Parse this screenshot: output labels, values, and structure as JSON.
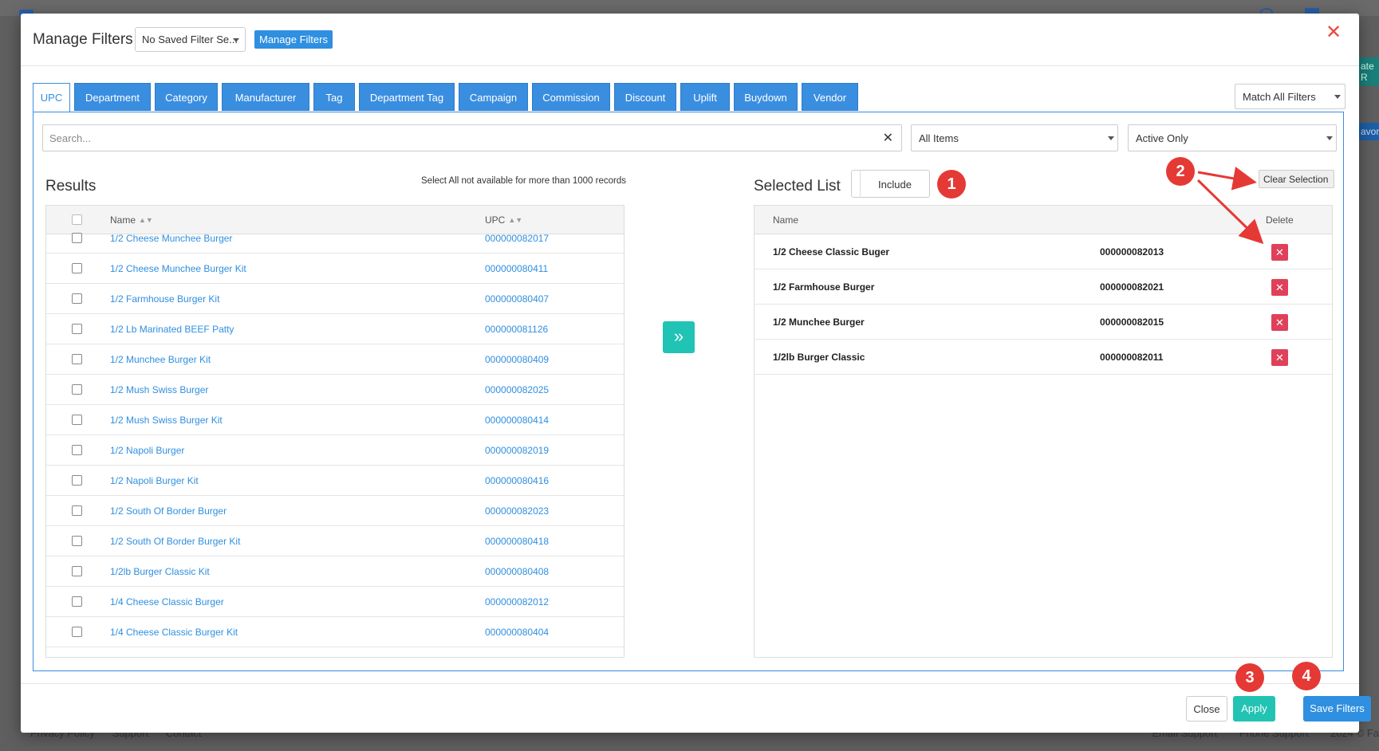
{
  "background": {
    "footer_links": [
      "Privacy Policy",
      "Support",
      "Contact"
    ],
    "footer_right": [
      "Email Support",
      "Phone Support",
      "2024 © Fa"
    ],
    "right_btn1": "ate R",
    "right_btn2": "avor"
  },
  "modal": {
    "title": "Manage Filters",
    "saved_filter_value": "No Saved Filter Se...",
    "manage_filters_button": "Manage Filters"
  },
  "tabs": [
    {
      "label": "UPC",
      "active": true
    },
    {
      "label": "Department"
    },
    {
      "label": "Category"
    },
    {
      "label": "Manufacturer"
    },
    {
      "label": "Tag"
    },
    {
      "label": "Department Tag"
    },
    {
      "label": "Campaign"
    },
    {
      "label": "Commission"
    },
    {
      "label": "Discount"
    },
    {
      "label": "Uplift"
    },
    {
      "label": "Buydown"
    },
    {
      "label": "Vendor"
    }
  ],
  "match_select": "Match All Filters",
  "search": {
    "placeholder": "Search..."
  },
  "items_filter": "All Items",
  "status_filter": "Active Only",
  "results": {
    "title": "Results",
    "note": "Select All not available for more than 1000 records",
    "columns": {
      "name": "Name",
      "upc": "UPC"
    },
    "rows": [
      {
        "name": "1/2 Cheese Munchee Burger",
        "upc": "000000082017"
      },
      {
        "name": "1/2 Cheese Munchee Burger Kit",
        "upc": "000000080411"
      },
      {
        "name": "1/2 Farmhouse Burger Kit",
        "upc": "000000080407"
      },
      {
        "name": "1/2 Lb Marinated BEEF Patty",
        "upc": "000000081126"
      },
      {
        "name": "1/2 Munchee Burger Kit",
        "upc": "000000080409"
      },
      {
        "name": "1/2 Mush Swiss Burger",
        "upc": "000000082025"
      },
      {
        "name": "1/2 Mush Swiss Burger Kit",
        "upc": "000000080414"
      },
      {
        "name": "1/2 Napoli Burger",
        "upc": "000000082019"
      },
      {
        "name": "1/2 Napoli Burger Kit",
        "upc": "000000080416"
      },
      {
        "name": "1/2 South Of Border Burger",
        "upc": "000000082023"
      },
      {
        "name": "1/2 South Of Border Burger Kit",
        "upc": "000000080418"
      },
      {
        "name": "1/2lb Burger Classic Kit",
        "upc": "000000080408"
      },
      {
        "name": "1/4 Cheese Classic Burger",
        "upc": "000000082012"
      },
      {
        "name": "1/4 Cheese Classic Burger Kit",
        "upc": "000000080404"
      }
    ]
  },
  "selected": {
    "title": "Selected List",
    "include_label": "Include",
    "clear_label": "Clear Selection",
    "columns": {
      "name": "Name",
      "delete": "Delete"
    },
    "rows": [
      {
        "name": "1/2 Cheese Classic Buger",
        "upc": "000000082013"
      },
      {
        "name": "1/2 Farmhouse Burger",
        "upc": "000000082021"
      },
      {
        "name": "1/2 Munchee Burger",
        "upc": "000000082015"
      },
      {
        "name": "1/2lb Burger Classic",
        "upc": "000000082011"
      }
    ]
  },
  "footer": {
    "close": "Close",
    "apply": "Apply",
    "save": "Save Filters"
  },
  "annotations": [
    "1",
    "2",
    "3",
    "4"
  ],
  "colors": {
    "primary": "#2f8fe0",
    "teal": "#20c3b4",
    "danger": "#e0405a",
    "annotation": "#e53935"
  }
}
